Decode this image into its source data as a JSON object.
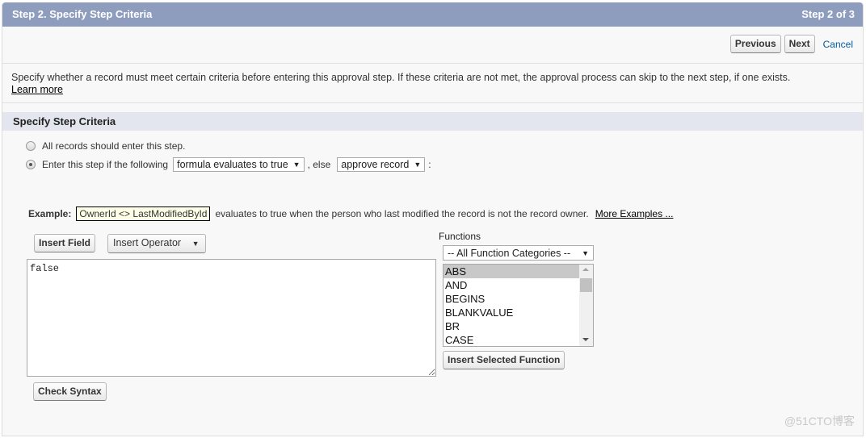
{
  "header": {
    "title": "Step 2. Specify Step Criteria",
    "step_indicator": "Step 2 of 3"
  },
  "nav": {
    "previous_label": "Previous",
    "next_label": "Next",
    "cancel_label": "Cancel"
  },
  "intro": {
    "text": "Specify whether a record must meet certain criteria before entering this approval step. If these criteria are not met, the approval process can skip to the next step, if one exists.",
    "learn_more": "Learn more"
  },
  "section": {
    "title": "Specify Step Criteria"
  },
  "criteria": {
    "option_all": "All records should enter this step.",
    "option_if": "Enter this step if the following",
    "condition_select": "formula evaluates to true",
    "else_text": ", else",
    "else_select": "approve record",
    "colon": ":",
    "selected_option": "option_if"
  },
  "example": {
    "label": "Example:",
    "code": "OwnerId <> LastModifiedById",
    "description": "evaluates to true when the person who last modified the record is not the record owner.",
    "more_examples": "More Examples ..."
  },
  "formula_editor": {
    "insert_field_label": "Insert Field",
    "insert_operator_label": "Insert Operator",
    "formula_value": "false",
    "check_syntax_label": "Check Syntax"
  },
  "functions": {
    "label": "Functions",
    "category_select": "-- All Function Categories --",
    "items": [
      "ABS",
      "AND",
      "BEGINS",
      "BLANKVALUE",
      "BR",
      "CASE"
    ],
    "selected": "ABS",
    "insert_label": "Insert Selected Function"
  },
  "watermark": "@51CTO博客"
}
